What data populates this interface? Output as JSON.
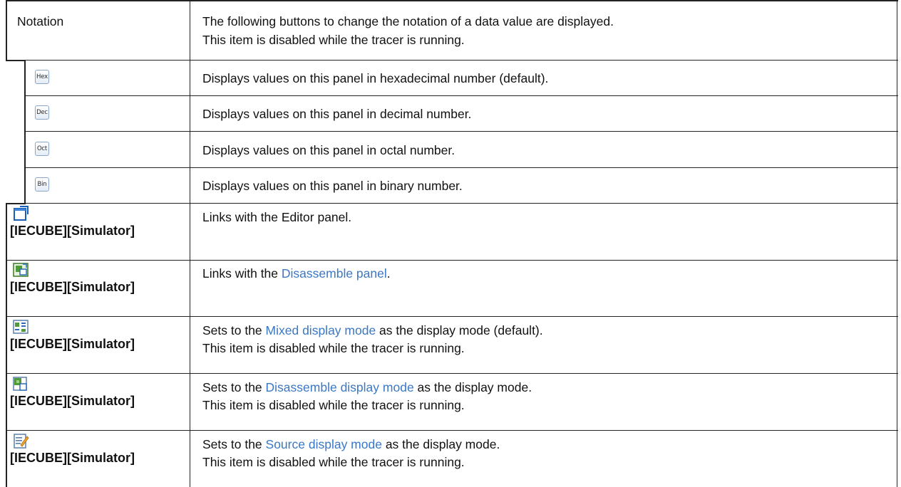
{
  "notation": {
    "label": "Notation",
    "desc_lines": [
      "The following buttons to change the notation of a data value are displayed.",
      "This item is disabled while the tracer is running."
    ]
  },
  "notation_buttons": [
    {
      "icon_text": "Hex",
      "icon": "hex-icon",
      "desc": "Displays values on this panel in hexadecimal number (default)."
    },
    {
      "icon_text": "Dec",
      "icon": "dec-icon",
      "desc": "Displays values on this panel in decimal number."
    },
    {
      "icon_text": "Oct",
      "icon": "oct-icon",
      "desc": "Displays values on this panel in octal number."
    },
    {
      "icon_text": "Bin",
      "icon": "bin-icon",
      "desc": "Displays values on this panel in binary number."
    }
  ],
  "toolbar_items": [
    {
      "icon": "editor-link-icon",
      "label": "[IECUBE][Simulator]",
      "line1": {
        "before": "Links with the Editor panel.",
        "link": "",
        "after": ""
      },
      "line2": ""
    },
    {
      "icon": "disassemble-link-icon",
      "label": "[IECUBE][Simulator]",
      "line1": {
        "before": "Links with the ",
        "link": "Disassemble panel",
        "after": "."
      },
      "line2": ""
    },
    {
      "icon": "mixed-mode-icon",
      "label": "[IECUBE][Simulator]",
      "line1": {
        "before": "Sets to the ",
        "link": "Mixed display mode",
        "after": " as the display mode (default)."
      },
      "line2": "This item is disabled while the tracer is running."
    },
    {
      "icon": "disassemble-mode-icon",
      "label": "[IECUBE][Simulator]",
      "line1": {
        "before": "Sets to the ",
        "link": "Disassemble display mode",
        "after": " as the display mode."
      },
      "line2": "This item is disabled while the tracer is running."
    },
    {
      "icon": "source-mode-icon",
      "label": "[IECUBE][Simulator]",
      "line1": {
        "before": "Sets to the ",
        "link": "Source display mode",
        "after": " as the display mode."
      },
      "line2": "This item is disabled while the tracer is running."
    }
  ],
  "colors": {
    "border": "#222222",
    "link": "#3a78c4"
  }
}
